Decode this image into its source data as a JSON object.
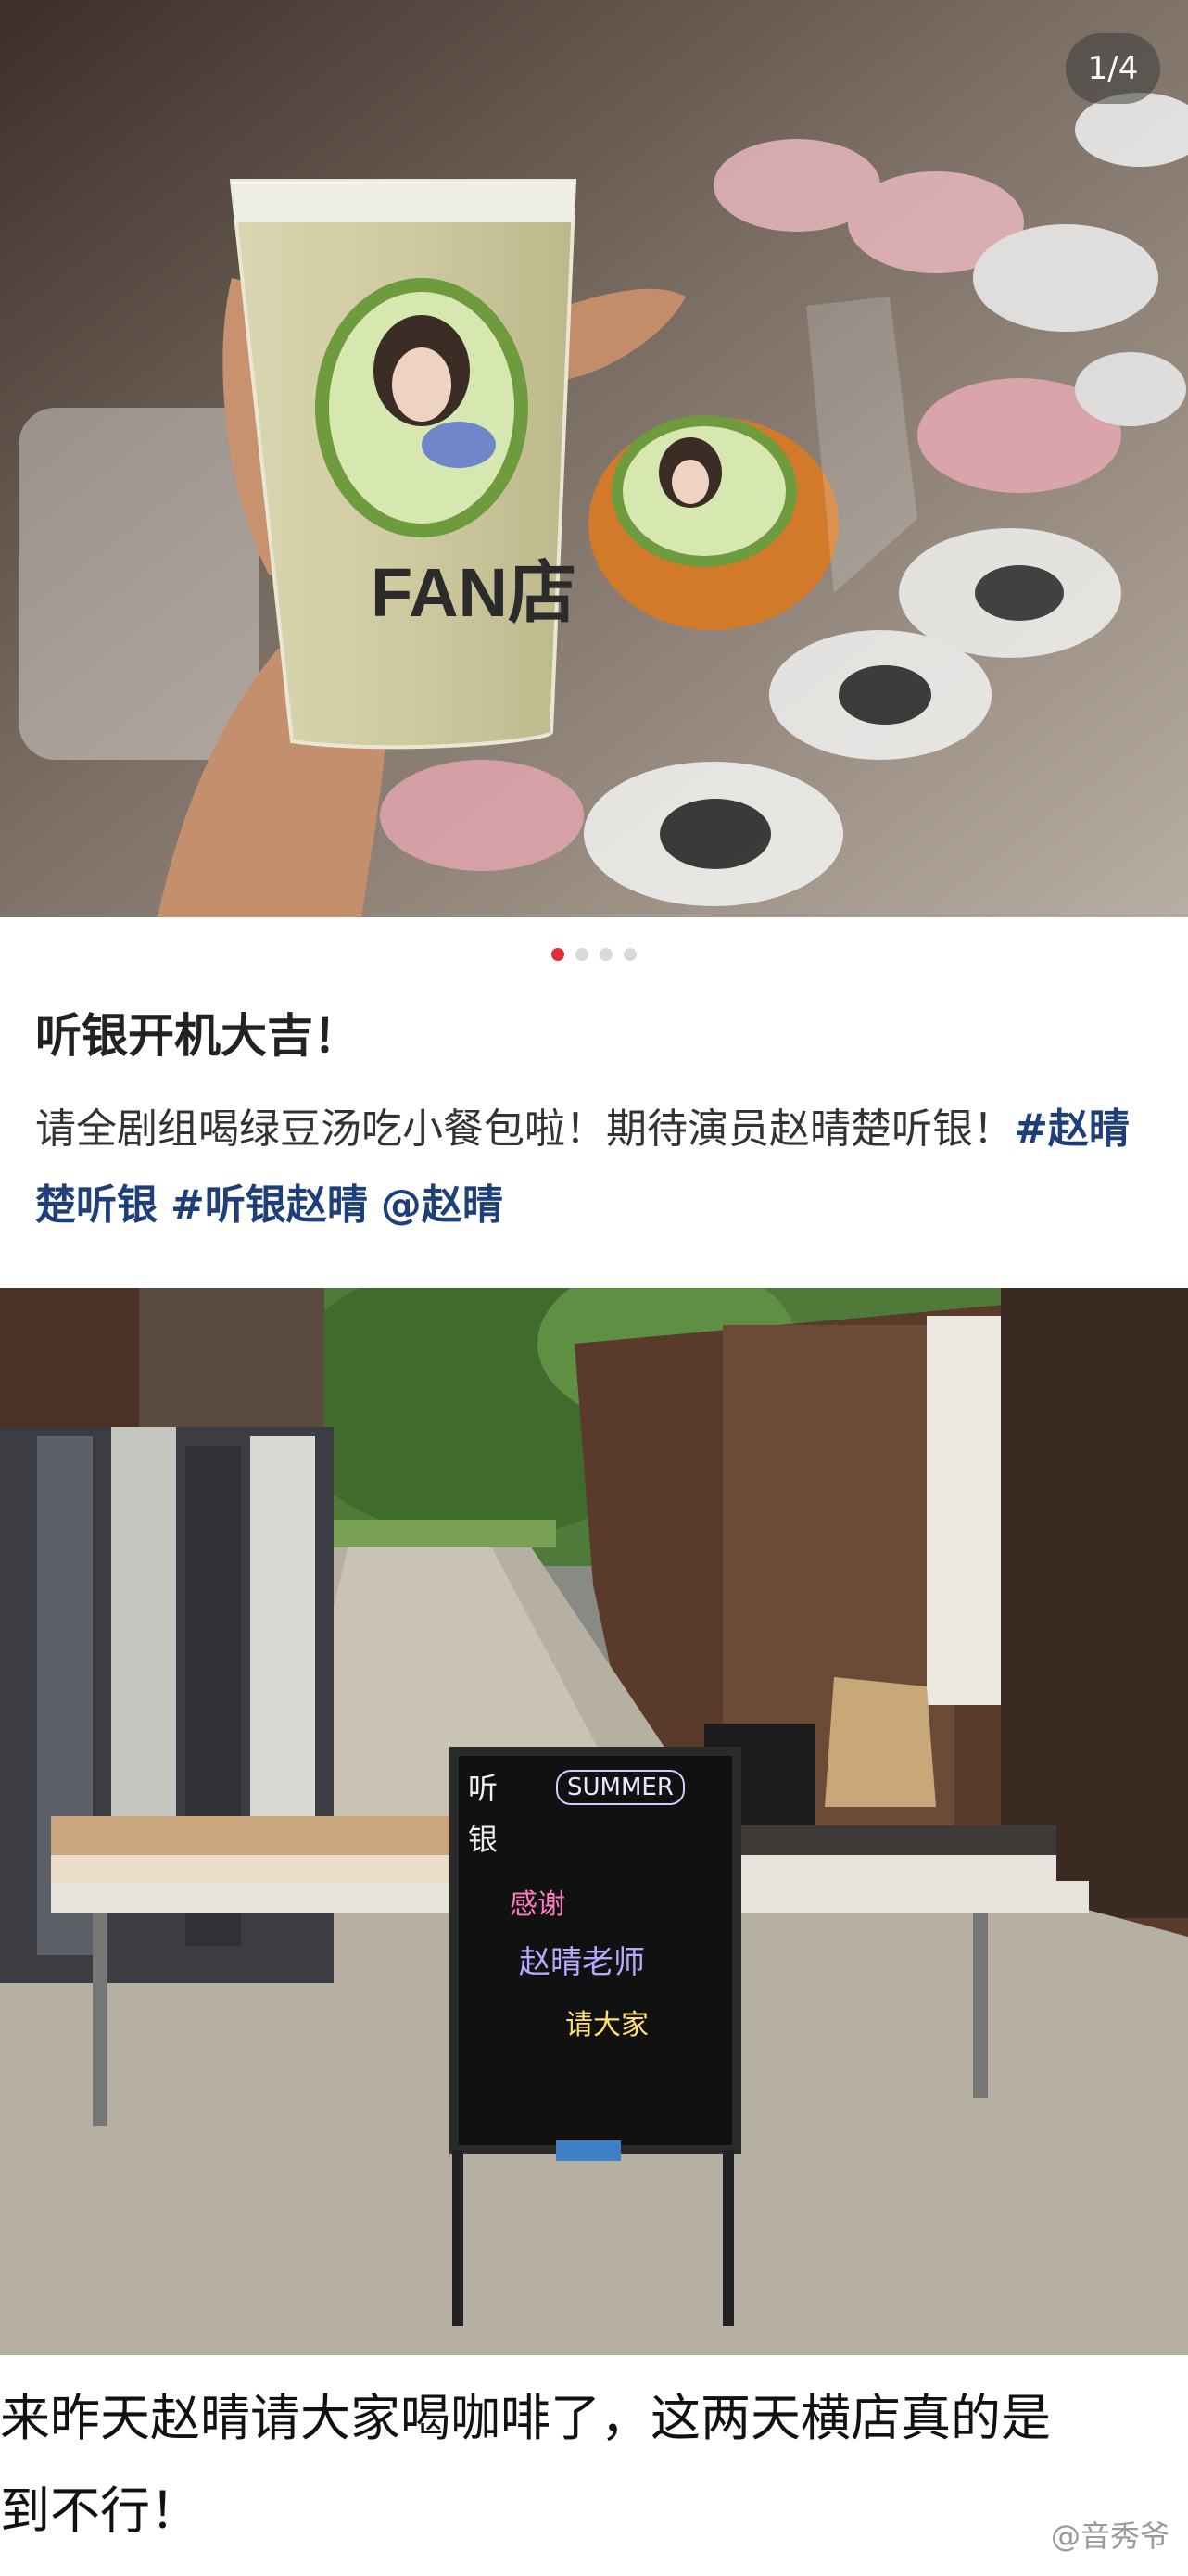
{
  "carousel": {
    "page_counter": "1/4",
    "cup_brand": "FAN店",
    "active_dot_index": 0,
    "dots_count": 4
  },
  "post": {
    "title": "听银开机大吉！",
    "body_text": "请全剧组喝绿豆汤吃小餐包啦！期待演员赵晴楚听银！",
    "hashtags": [
      "#赵晴楚听银",
      "#听银赵晴",
      "@赵晴"
    ]
  },
  "photo2": {
    "board_lines": [
      "听",
      "银",
      "SUMMER",
      "感谢",
      "赵晴老师",
      "请大家"
    ]
  },
  "comment": {
    "line1": "来昨天赵晴请大家喝咖啡了，这两天横店真的是",
    "line2": "到不行！",
    "watermark": "@音秀爷"
  },
  "colors": {
    "accent_red": "#e02e3a",
    "hashtag_blue": "#1f3f7a"
  }
}
